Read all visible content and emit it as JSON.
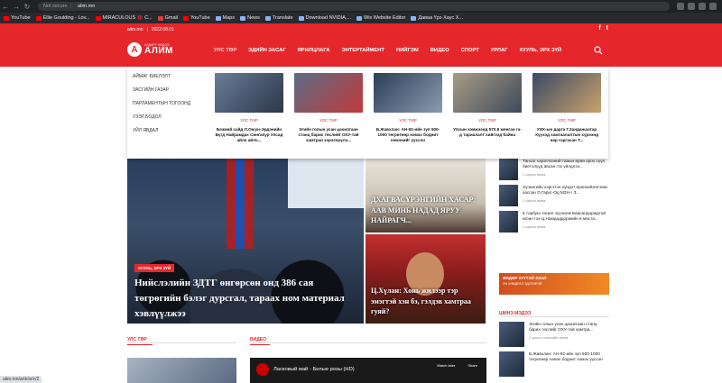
{
  "browser": {
    "security": "Not secure",
    "url": "alim.mn",
    "bookmarks": [
      {
        "label": "YouTube",
        "icon": "youtube-icon"
      },
      {
        "label": "Ellie Goulding - Lov...",
        "icon": "youtube-icon"
      },
      {
        "label": "MIRACULOUS 🐞 C...",
        "icon": "youtube-icon"
      },
      {
        "label": "Gmail",
        "icon": "gmail-icon"
      },
      {
        "label": "YouTube",
        "icon": "youtube-icon"
      },
      {
        "label": "Maps",
        "icon": "maps-icon"
      },
      {
        "label": "News",
        "icon": "news-icon"
      },
      {
        "label": "Translate",
        "icon": "translate-icon"
      },
      {
        "label": "Download NVIDIA,...",
        "icon": "nvidia-icon"
      },
      {
        "label": "Wix Website Editor",
        "icon": "wix-icon"
      },
      {
        "label": "Даваа Үрэ Хаус Х...",
        "icon": "page-icon"
      }
    ]
  },
  "topstrip": {
    "site": "alim.mn",
    "date": "2022.08.01"
  },
  "logo": {
    "text": "АЛИМ",
    "tagline": "АЛДАРТ МЭДЭЭ"
  },
  "nav": {
    "items": [
      "УЛС ТӨР",
      "ЭДИЙН ЗАСАГ",
      "ЯРИЛЦЛАГА",
      "ЭНТЕРТАЙМЕНТ",
      "НИЙГЭМ",
      "ВИДЕО",
      "СПОРТ",
      "УРЛАГ",
      "ХУУЛЬ, ЭРХ ЗҮЙ"
    ]
  },
  "dropdown": {
    "left": [
      "АЙМАГ БИЕЛЭЛТ",
      "ЗАСГИЙН ГАЗАР",
      "ПАРЛАМЕНТЫН ТОГООНД",
      "УЗЭЛ БОДОЛ",
      "УЙЛ ЯВДАЛ"
    ],
    "cards": [
      {
        "cat": "УЛС ТӨР",
        "title": "Бээжий сайд Л.Оюун-Эрдэнийн Бүгд Найрамдах Сингапур Улсад айлч айлч..."
      },
      {
        "cat": "УЛС ТӨР",
        "title": "Эгийн голын усан цахилгаан станц барих төслийг ОХУ-тай хамтран хэрэгжүүлэ..."
      },
      {
        "cat": "УЛС ТӨР",
        "title": "Б.Жавхлан: АН-92-ийн зүп 500-1000 төгрөгөөр нэмэх боднит нэмэхийг үүссэн"
      },
      {
        "cat": "УЛС ТӨР",
        "title": "Улсын хэмжээнд 570.8 мянган га-д тариалалт хийгээд байна"
      },
      {
        "cat": "УЛС ТӨР",
        "title": "УИХ-ын дарга Г.Занданшатар Хүүхэд хамгаалалтын хүрээнд нэр гаргасан Т..."
      }
    ]
  },
  "hero": {
    "badge": "ХУУЛЬ, ЭРХ ЗҮЙ",
    "title": "Нийслэлийн ЗДТГ өнгөрсөн онд 386 сая төгрөгийн бэлэг дурсгал, тараах ном материал хэвлүүлжээ"
  },
  "side1": {
    "title": "ДХАГВАСҮРЭНГИЙН ХАСАР: ААВ МИНЬ НАДАД ЯРУУ НАЙРАГЧ..."
  },
  "side2": {
    "title": "Ц.Хүлан: Хонь жилээр тэр эмэгтэй хэн бэ, гэлдэв хамтраа гуяй?"
  },
  "right_list": [
    {
      "text": "Тансаг хэрэглээний тааын өрөө орох сүүл биетэлүүд авсан гэх үйлдлээ...",
      "time": "1 сарын өмнө"
    },
    {
      "text": "Хүчингийн хэргэтэн хүндэт ерөнхийлөгчөөс хассан О.Гарьт-Од МЗН-г 3...",
      "time": "1 сарын өмнө"
    },
    {
      "text": "5 торбуш төгрөг зүүчилж Баасандорждтой өгсөн гэх Ц.Намдаддоржийн 6 маста...",
      "time": "1 сарын өмнө"
    }
  ],
  "banner": {
    "title": "ӨНДӨР ХҮҮТЭЙ ЗЭЭЛ",
    "sub": "3% ХЯМДРАЛ ЭДЛЭЭРЭЙ"
  },
  "sections": {
    "left": "УЛС ТӨР",
    "middle": "ВИДЕО",
    "right": "ШИНЭ МЭДЭЭ"
  },
  "right_list2": [
    {
      "text": "Эгийн голын усан цахилгаан станц барих төслийг ОХУ-тай хамтра...",
      "time": "2 долоо хоногийн өмнө"
    },
    {
      "text": "Б.Жавхлан: АН-92-ийн зүп 500-1000 төгрөгөөр нэмэх боднит нэмэх үүссэн",
      "time": ""
    }
  ],
  "video": {
    "title": "Ласковый май - Белые розы (HD)",
    "watch_later": "Watch later",
    "share": "Share"
  },
  "status_url": "alim.mn/article/c/2"
}
